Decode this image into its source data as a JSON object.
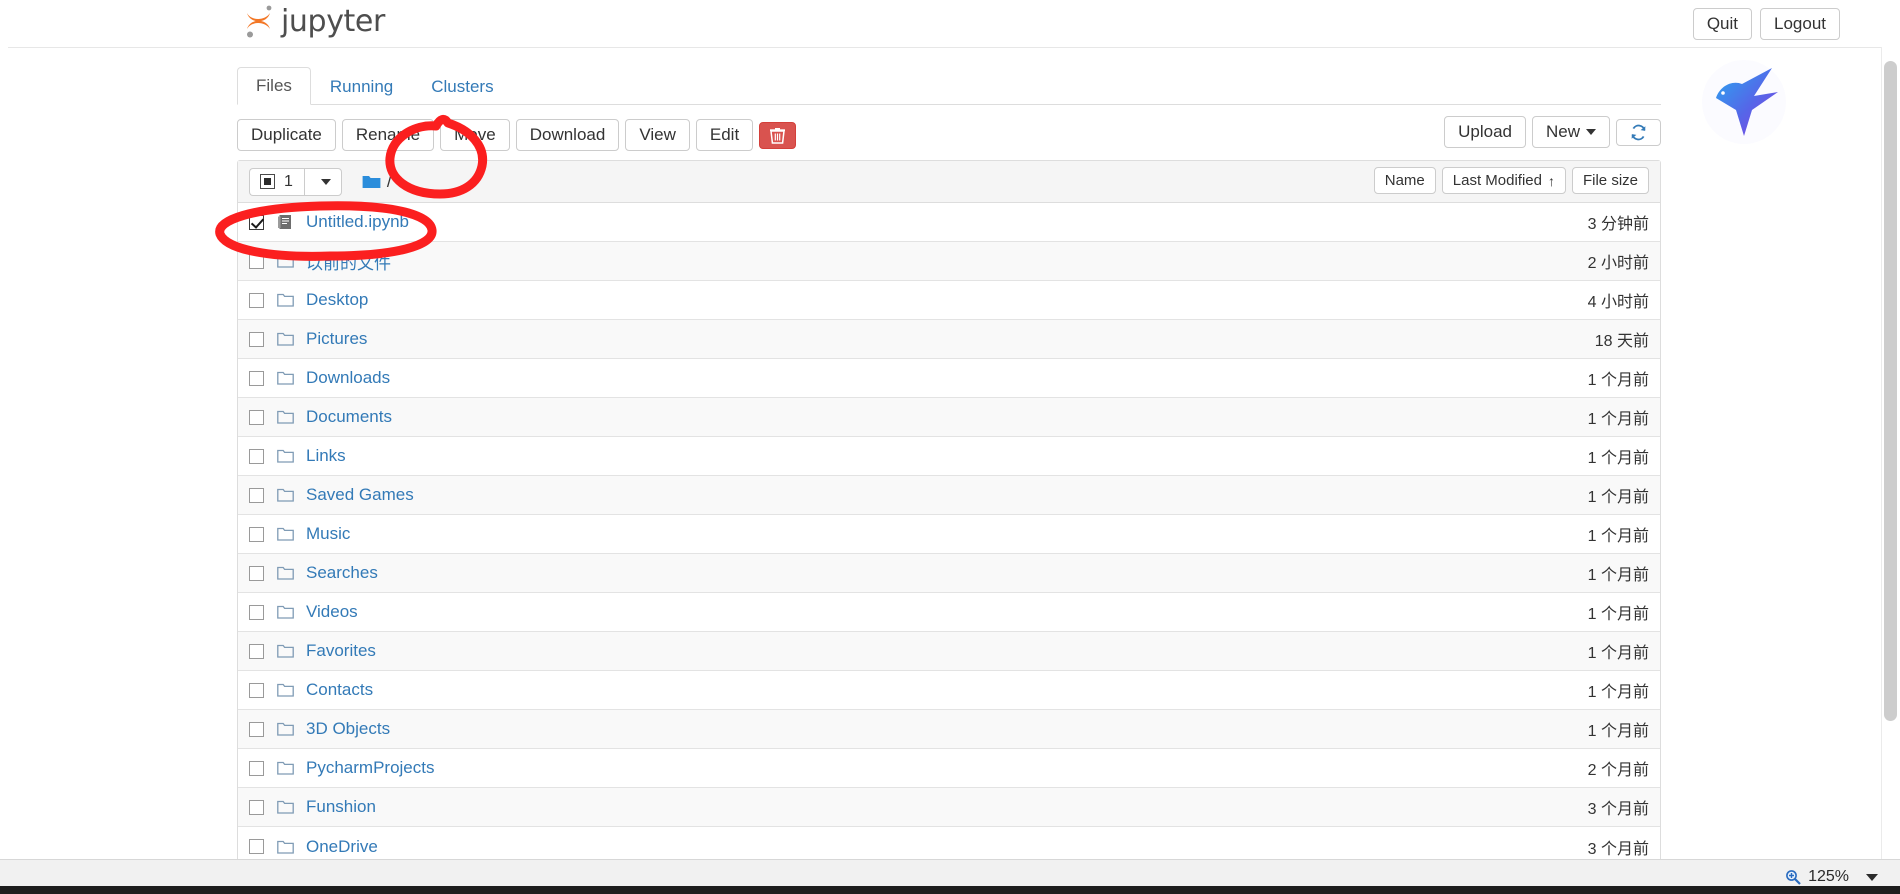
{
  "header": {
    "logo_text": "jupyter",
    "logo_icon": "jupyter-logo-icon",
    "quit_label": "Quit",
    "logout_label": "Logout"
  },
  "tabs": [
    {
      "label": "Files",
      "active": true
    },
    {
      "label": "Running",
      "active": false
    },
    {
      "label": "Clusters",
      "active": false
    }
  ],
  "toolbar": {
    "duplicate_label": "Duplicate",
    "rename_label": "Rename",
    "move_label": "Move",
    "download_label": "Download",
    "view_label": "View",
    "edit_label": "Edit",
    "delete_icon": "trash-icon",
    "upload_label": "Upload",
    "new_label": "New",
    "refresh_icon": "refresh-icon"
  },
  "list_header": {
    "select_count": "1",
    "select_checkbox_state": "indeterminate",
    "select_caret_icon": "chevron-down-icon",
    "breadcrumb_icon": "folder-icon",
    "breadcrumb_path": "/",
    "sort_name_label": "Name",
    "sort_modified_label": "Last Modified",
    "sort_modified_arrow": "↑",
    "sort_size_label": "File size"
  },
  "files": [
    {
      "name": "Untitled.ipynb",
      "icon": "notebook-icon",
      "modified": "3 分钟前",
      "checked": true
    },
    {
      "name": "以前的文件",
      "icon": "folder-icon",
      "modified": "2 小时前",
      "checked": false
    },
    {
      "name": "Desktop",
      "icon": "folder-icon",
      "modified": "4 小时前",
      "checked": false
    },
    {
      "name": "Pictures",
      "icon": "folder-icon",
      "modified": "18 天前",
      "checked": false
    },
    {
      "name": "Downloads",
      "icon": "folder-icon",
      "modified": "1 个月前",
      "checked": false
    },
    {
      "name": "Documents",
      "icon": "folder-icon",
      "modified": "1 个月前",
      "checked": false
    },
    {
      "name": "Links",
      "icon": "folder-icon",
      "modified": "1 个月前",
      "checked": false
    },
    {
      "name": "Saved Games",
      "icon": "folder-icon",
      "modified": "1 个月前",
      "checked": false
    },
    {
      "name": "Music",
      "icon": "folder-icon",
      "modified": "1 个月前",
      "checked": false
    },
    {
      "name": "Searches",
      "icon": "folder-icon",
      "modified": "1 个月前",
      "checked": false
    },
    {
      "name": "Videos",
      "icon": "folder-icon",
      "modified": "1 个月前",
      "checked": false
    },
    {
      "name": "Favorites",
      "icon": "folder-icon",
      "modified": "1 个月前",
      "checked": false
    },
    {
      "name": "Contacts",
      "icon": "folder-icon",
      "modified": "1 个月前",
      "checked": false
    },
    {
      "name": "3D Objects",
      "icon": "folder-icon",
      "modified": "1 个月前",
      "checked": false
    },
    {
      "name": "PycharmProjects",
      "icon": "folder-icon",
      "modified": "2 个月前",
      "checked": false
    },
    {
      "name": "Funshion",
      "icon": "folder-icon",
      "modified": "3 个月前",
      "checked": false
    },
    {
      "name": "OneDrive",
      "icon": "folder-icon",
      "modified": "3 个月前",
      "checked": false
    }
  ],
  "annotations": {
    "color": "#fb1f1f",
    "move_circle": "hand-drawn-circle-around-move-button",
    "file_circle": "hand-drawn-ellipse-around-selected-file-row"
  },
  "overlay": {
    "bird_logo": "hummingbird-logo-icon"
  },
  "statusbar": {
    "zoom_icon": "zoom-magnifier-icon",
    "zoom_level": "125%",
    "zoom_caret_icon": "chevron-down-icon"
  }
}
